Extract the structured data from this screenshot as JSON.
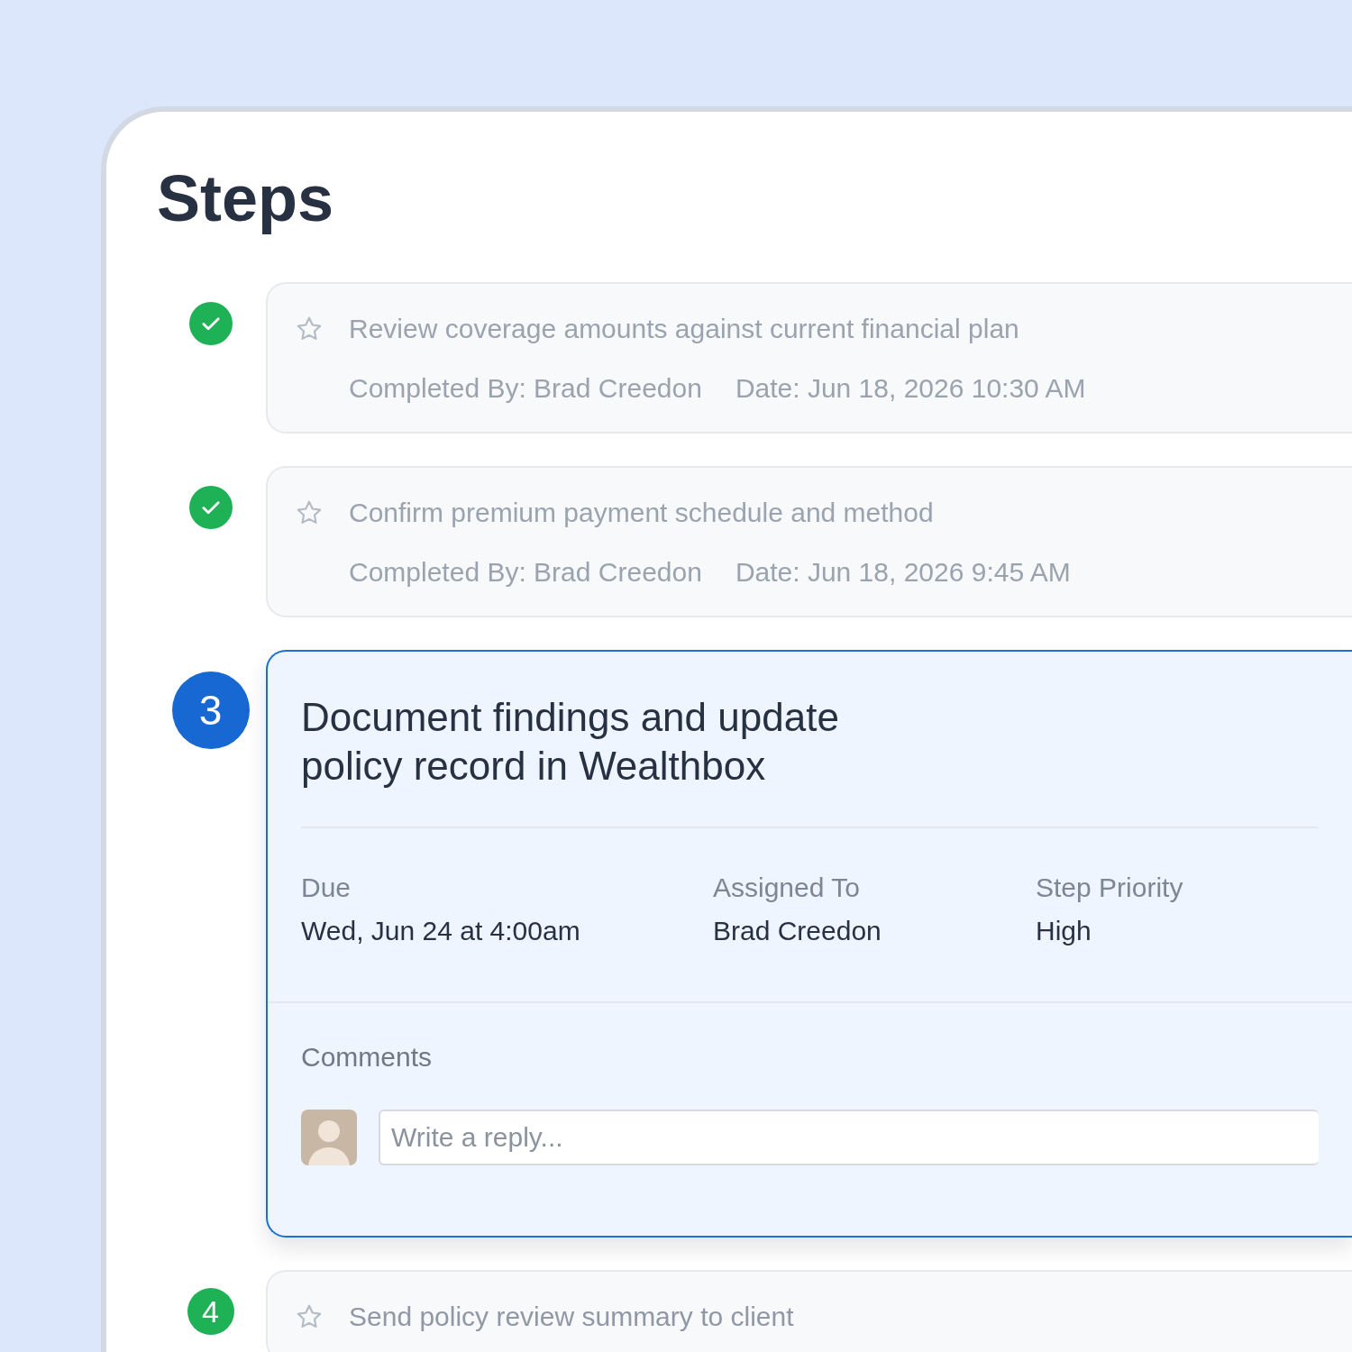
{
  "title": "Steps",
  "steps": [
    {
      "completed": true,
      "current": false,
      "title": "Review coverage amounts against current financial plan",
      "completed_by": "Completed By: Brad Creedon",
      "date": "Date: Jun 18, 2026 10:30 AM"
    },
    {
      "completed": true,
      "current": false,
      "title": "Confirm premium payment schedule and method",
      "completed_by": "Completed By: Brad Creedon",
      "date": "Date: Jun 18, 2026 9:45 AM"
    },
    {
      "completed": false,
      "current": true,
      "number": "3",
      "title": "Document findings and update policy record in Wealthbox",
      "fields": [
        {
          "label": "Due",
          "value": "Wed, Jun 24 at 4:00am"
        },
        {
          "label": "Assigned To",
          "value": "Brad Creedon"
        },
        {
          "label": "Step Priority",
          "value": "High"
        }
      ],
      "comments": {
        "heading": "Comments",
        "placeholder": "Write a reply..."
      }
    },
    {
      "completed": false,
      "current": false,
      "number": "4",
      "title": "Send policy review summary to client"
    }
  ]
}
